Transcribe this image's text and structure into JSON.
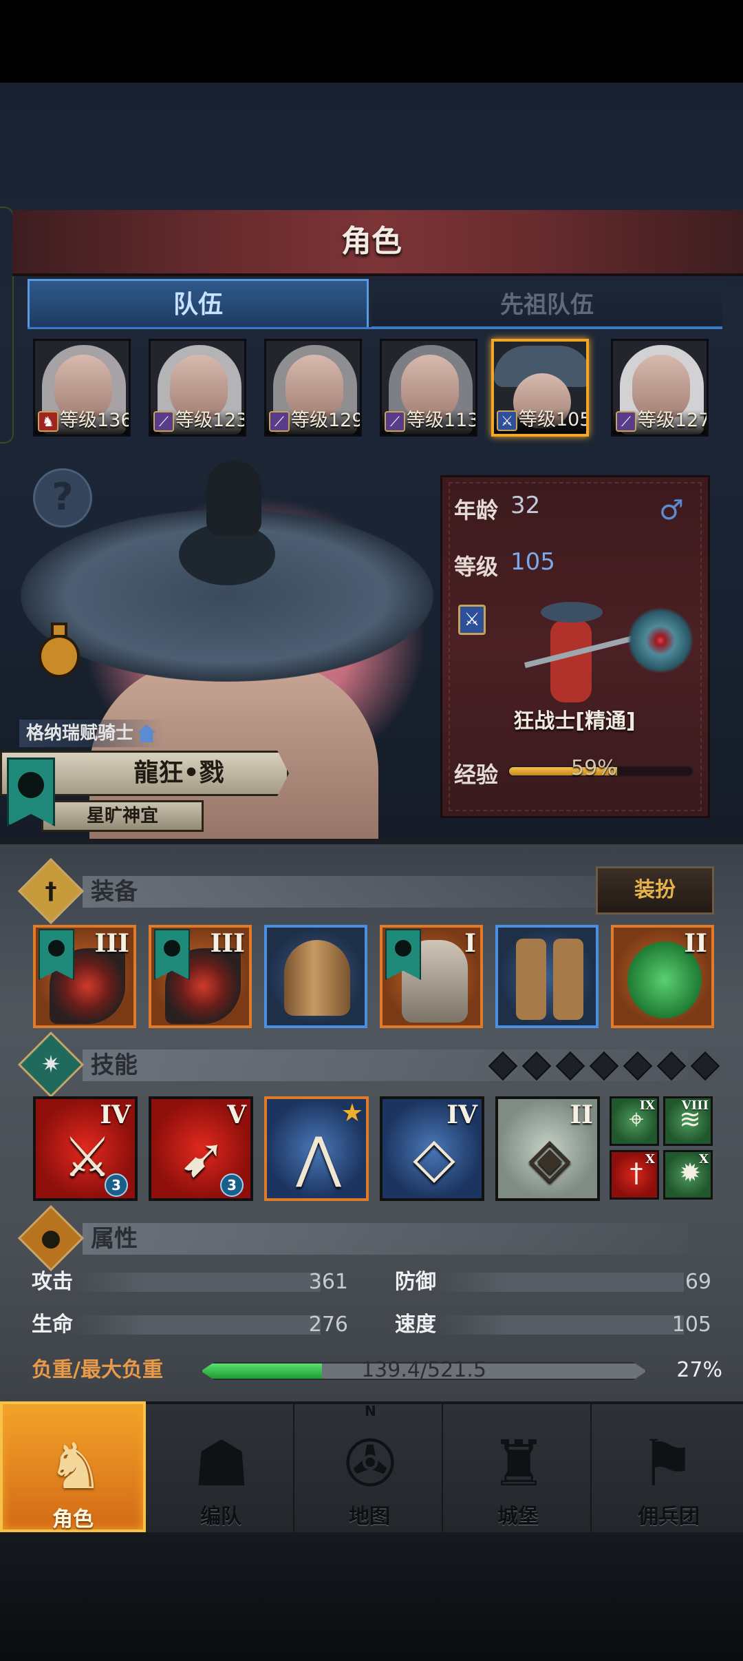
{
  "header": {
    "title": "角色"
  },
  "tabs": [
    {
      "label": "队伍",
      "active": true
    },
    {
      "label": "先祖队伍",
      "active": false
    }
  ],
  "team": [
    {
      "level": "等级136",
      "class_icon": "horse-icon",
      "class_color": "#a0241f"
    },
    {
      "level": "等级123",
      "class_icon": "wand-icon",
      "class_color": "#5a3d8a"
    },
    {
      "level": "等级129",
      "class_icon": "wand-icon",
      "class_color": "#5a3d8a"
    },
    {
      "level": "等级113",
      "class_icon": "wand-icon",
      "class_color": "#5a3d8a"
    },
    {
      "level": "等级105",
      "class_icon": "sword-icon",
      "class_color": "#2e4f9a",
      "selected": true
    },
    {
      "level": "等级127",
      "class_icon": "wand-icon",
      "class_color": "#5a3d8a"
    }
  ],
  "character": {
    "faction": "格纳瑞赋骑士",
    "name": "龍狂•戮",
    "title": "星旷神宜"
  },
  "info_card": {
    "age_label": "年龄",
    "age": "32",
    "gender_icon": "male-icon",
    "level_label": "等级",
    "level": "105",
    "class_name": "狂战士[精通]",
    "exp_label": "经验",
    "exp_text": "59%",
    "exp_fraction": 0.59
  },
  "equipment": {
    "title": "装备",
    "dress_button": "装扮",
    "slots": [
      {
        "name": "axe",
        "rank": "III",
        "rarity": "orange",
        "flag": true
      },
      {
        "name": "axe",
        "rank": "III",
        "rarity": "orange",
        "flag": true
      },
      {
        "name": "helmet",
        "rank": "",
        "rarity": "blue",
        "flag": false
      },
      {
        "name": "armor",
        "rank": "I",
        "rarity": "orange",
        "flag": true
      },
      {
        "name": "boots",
        "rank": "",
        "rarity": "blue",
        "flag": false
      },
      {
        "name": "jade-amulet",
        "rank": "II",
        "rarity": "orange",
        "flag": false
      }
    ]
  },
  "skills": {
    "title": "技能",
    "list": [
      {
        "rank": "IV",
        "color": "red",
        "badge": "3"
      },
      {
        "rank": "V",
        "color": "red",
        "badge": "3"
      },
      {
        "rank": "",
        "color": "blue",
        "star": true
      },
      {
        "rank": "IV",
        "color": "blue"
      },
      {
        "rank": "II",
        "color": "gray"
      }
    ],
    "mini": [
      {
        "rank": "IX",
        "color": "green",
        "glyph": "target-icon"
      },
      {
        "rank": "VIII",
        "color": "green",
        "glyph": "claw-icon"
      },
      {
        "rank": "X",
        "color": "red",
        "glyph": "dagger-icon"
      },
      {
        "rank": "X",
        "color": "green",
        "glyph": "burst-icon"
      }
    ]
  },
  "attributes": {
    "title": "属性",
    "attack_label": "攻击",
    "attack": "361",
    "defense_label": "防御",
    "defense": "69",
    "hp_label": "生命",
    "hp": "276",
    "speed_label": "速度",
    "speed": "105",
    "weight_label": "负重/最大负重",
    "weight_text": "139.4/521.5",
    "weight_pct": "27%",
    "weight_fraction": 0.27
  },
  "nav": [
    {
      "label": "角色",
      "icon": "knight-icon",
      "active": true
    },
    {
      "label": "编队",
      "icon": "helmet-icon"
    },
    {
      "label": "地图",
      "icon": "compass-icon",
      "compass_mark": "N"
    },
    {
      "label": "城堡",
      "icon": "castle-icon"
    },
    {
      "label": "佣兵团",
      "icon": "mercenary-icon"
    }
  ]
}
